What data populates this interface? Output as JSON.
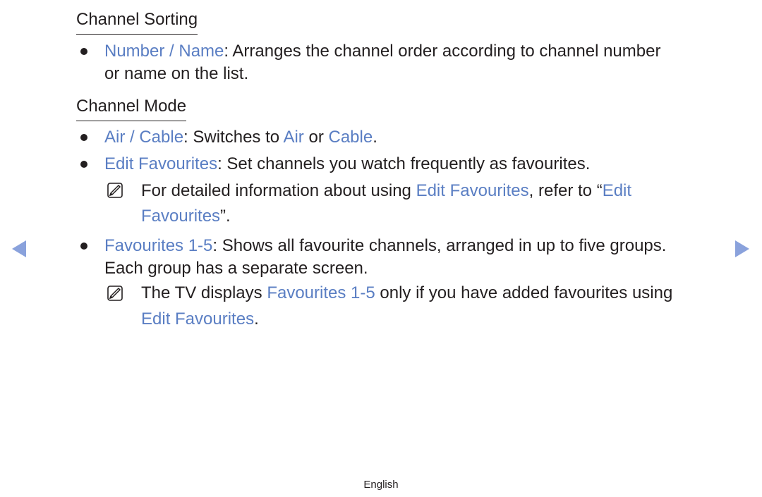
{
  "sections": [
    {
      "heading": "Channel Sorting",
      "items": [
        {
          "term": "Number / Name",
          "desc_line1": ": Arranges the channel order according to channel number",
          "desc_line2": "or name on the list."
        }
      ]
    },
    {
      "heading": "Channel Mode",
      "items": [
        {
          "term": "Air / Cable",
          "sep": ": Switches to ",
          "air": "Air",
          "or": " or ",
          "cable": "Cable",
          "end": "."
        },
        {
          "term": "Edit Favourites",
          "desc": ": Set channels you watch frequently as favourites."
        },
        {
          "note_pre": "For detailed information about using ",
          "note_term": "Edit Favourites",
          "note_mid": ", refer to “",
          "note_ref1": "Edit",
          "note_ref2": "Favourites",
          "note_end": "”."
        },
        {
          "term": "Favourites 1-5",
          "desc_line1": ": Shows all favourite channels, arranged in up to five groups.",
          "desc_line2": "Each group has a separate screen."
        },
        {
          "note_pre": "The TV displays ",
          "note_term": "Favourites 1-5",
          "note_mid": " only if you have added favourites using",
          "note_term2": "Edit Favourites",
          "note_end": "."
        }
      ]
    }
  ],
  "nav": {
    "prev": "previous-page",
    "next": "next-page"
  },
  "footer": {
    "language": "English"
  }
}
